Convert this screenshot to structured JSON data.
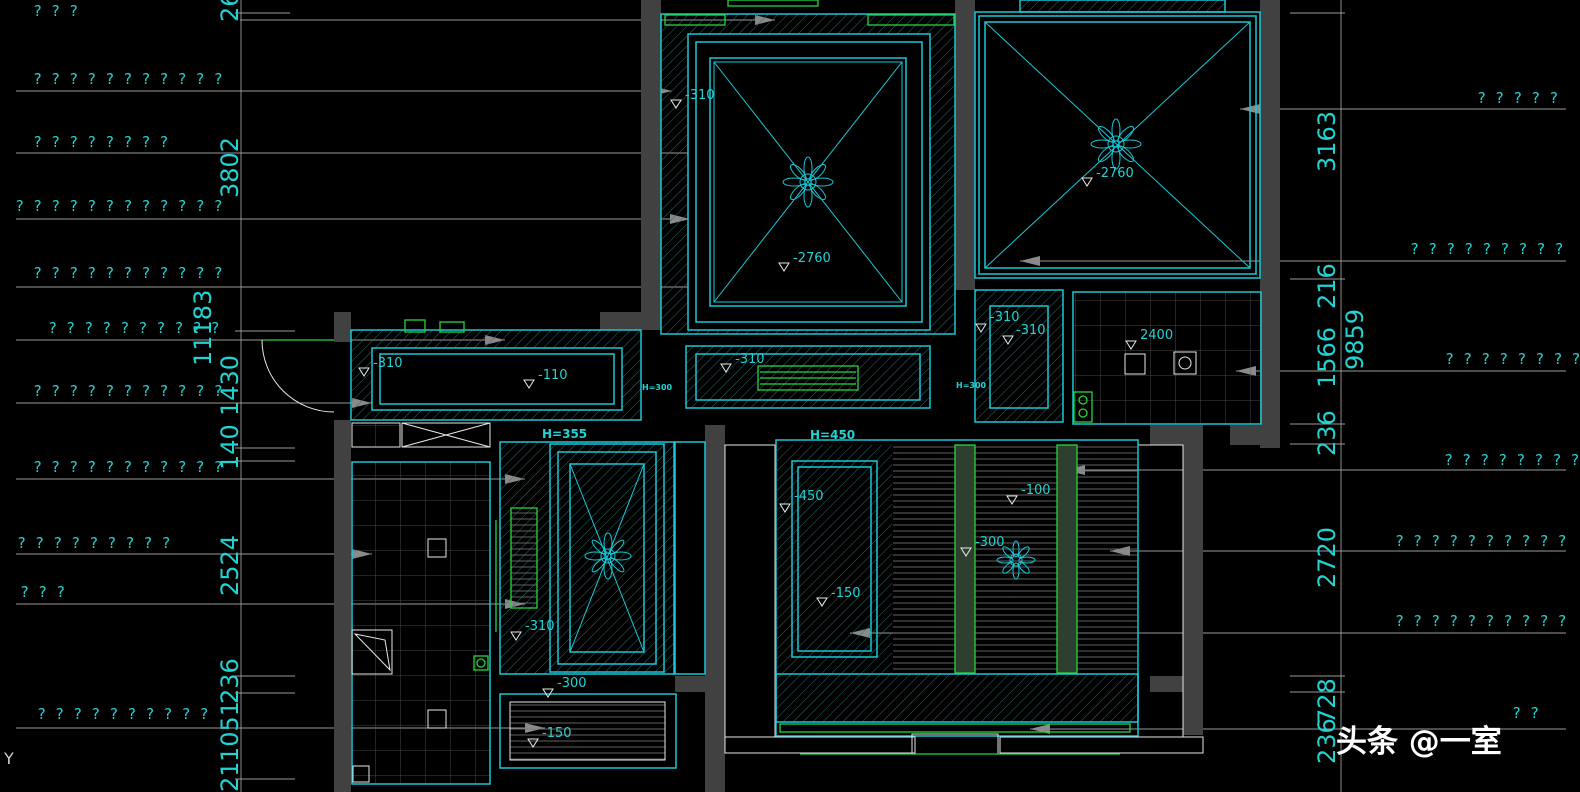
{
  "left_labels": [
    "? ? ?",
    "? ? ? ? ? ? ? ? ? ? ?",
    "? ? ? ? ? ? ? ?",
    "? ? ? ? ? ? ? ? ? ? ? ?",
    "? ? ? ? ? ? ? ? ? ? ?",
    "? ? ? ? ? ? ? ? ? ?",
    "? ? ? ? ? ? ? ? ? ? ?",
    "? ? ? ? ? ? ? ? ? ? ?",
    "? ? ? ? ? ? ? ? ?",
    "? ? ?",
    "? ? ? ? ? ? ? ? ? ?"
  ],
  "right_labels": [
    "? ? ? ? ?",
    "? ? ? ? ? ? ? ? ?",
    "? ? ? ? ? ? ? ?",
    "? ? ? ? ? ? ? ?",
    "? ? ? ? ? ? ? ? ? ?",
    "? ? ? ? ? ? ? ? ? ?",
    "? ?"
  ],
  "left_dimensions": [
    "26",
    "3802",
    "11183",
    "1430",
    "140",
    "2524",
    "236",
    "1051",
    "21"
  ],
  "right_dimensions": [
    "3163",
    "216",
    "1566",
    "9859",
    "236",
    "2720",
    "236",
    "728"
  ],
  "elevations": [
    "-310",
    "-2760",
    "-2760",
    "-310",
    "-110",
    "-310",
    "-310",
    "-310",
    "2400",
    "-450",
    "-100",
    "-300",
    "-150",
    "-310",
    "-300",
    "-150"
  ],
  "heights": [
    "H=355",
    "H=450",
    "H=300",
    "H=300"
  ],
  "watermark": "头条 @一室",
  "axis_mark": "Y",
  "colors": {
    "background": "#000000",
    "annotation": "#22d3d3",
    "wall": "#414141",
    "green": "#26d63a",
    "white": "#e8e8e8"
  }
}
